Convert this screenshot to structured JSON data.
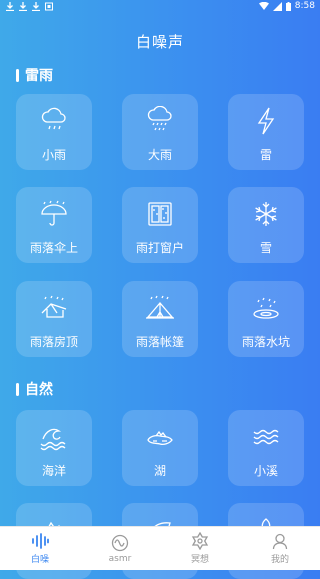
{
  "status": {
    "time": "8:58"
  },
  "title": "白噪声",
  "sections": [
    {
      "title": "雷雨",
      "items": [
        {
          "label": "小雨",
          "icon": "cloud-rain-light-icon"
        },
        {
          "label": "大雨",
          "icon": "cloud-rain-heavy-icon"
        },
        {
          "label": "雷",
          "icon": "lightning-icon"
        },
        {
          "label": "雨落伞上",
          "icon": "umbrella-rain-icon"
        },
        {
          "label": "雨打窗户",
          "icon": "window-rain-icon"
        },
        {
          "label": "雪",
          "icon": "snowflake-icon"
        },
        {
          "label": "雨落房顶",
          "icon": "roof-rain-icon"
        },
        {
          "label": "雨落帐篷",
          "icon": "tent-rain-icon"
        },
        {
          "label": "雨落水坑",
          "icon": "puddle-rain-icon"
        }
      ]
    },
    {
      "title": "自然",
      "items": [
        {
          "label": "海洋",
          "icon": "ocean-wave-icon"
        },
        {
          "label": "湖",
          "icon": "lake-icon"
        },
        {
          "label": "小溪",
          "icon": "stream-icon"
        },
        {
          "label": "",
          "icon": "mountain-icon"
        },
        {
          "label": "",
          "icon": "leaf-icon"
        },
        {
          "label": "",
          "icon": "nature-icon"
        }
      ]
    }
  ],
  "tabs": [
    {
      "label": "白噪",
      "icon": "soundwave-icon",
      "active": true
    },
    {
      "label": "asmr",
      "icon": "asmr-icon",
      "active": false
    },
    {
      "label": "冥想",
      "icon": "meditation-icon",
      "active": false
    },
    {
      "label": "我的",
      "icon": "profile-icon",
      "active": false
    }
  ],
  "colors": {
    "accent": "#3a86f0",
    "bg_start": "#3fa9e9",
    "bg_end": "#3a7df2"
  }
}
